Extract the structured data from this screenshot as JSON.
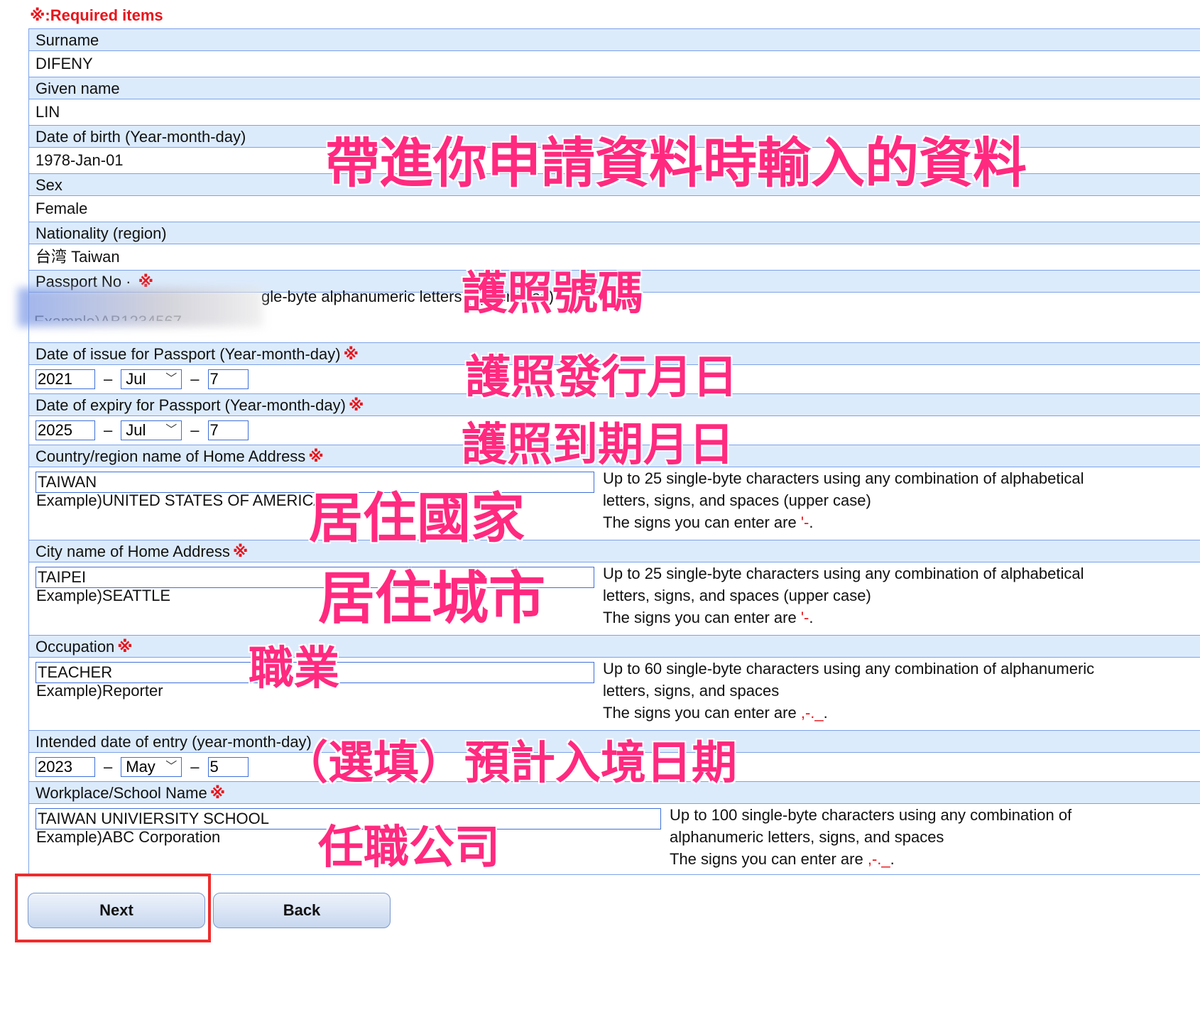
{
  "required_note": "※:Required items",
  "required_mark": "※",
  "fields": {
    "surname": {
      "label": "Surname",
      "value": "DIFENY"
    },
    "given_name": {
      "label": "Given name",
      "value": "LIN"
    },
    "dob": {
      "label": "Date of birth (Year-month-day)",
      "value": "1978-Jan-01"
    },
    "sex": {
      "label": "Sex",
      "value": "Female"
    },
    "nationality": {
      "label": "Nationality (region)",
      "value": "台湾 Taiwan"
    },
    "passport_no": {
      "label": "Passport No ·",
      "hint": "gle-byte alphanumeric letters (upper case)",
      "example": "Example)AB1234567"
    },
    "issue_date": {
      "label": "Date of issue for Passport (Year-month-day)",
      "year": "2021",
      "month": "Jul",
      "day": "7"
    },
    "expiry_date": {
      "label": "Date of expiry for Passport (Year-month-day)",
      "year": "2025",
      "month": "Jul",
      "day": "7"
    },
    "country": {
      "label": "Country/region name of Home Address",
      "value": "TAIWAN",
      "example": "Example)UNITED STATES OF AMERICA",
      "hint1": "Up to 25 single-byte characters using any combination of alphabetical",
      "hint2": "letters, signs, and spaces (upper case)",
      "hint3": "The signs you can enter are ",
      "signs": "'-",
      "hint_end": "."
    },
    "city": {
      "label": "City name of Home Address",
      "value": "TAIPEI",
      "example": "Example)SEATTLE",
      "hint1": "Up to 25 single-byte characters using any combination of alphabetical",
      "hint2": "letters, signs, and spaces (upper case)",
      "hint3": "The signs you can enter are ",
      "signs": "'-",
      "hint_end": "."
    },
    "occupation": {
      "label": "Occupation",
      "value": "TEACHER",
      "example": "Example)Reporter",
      "hint1": "Up to 60 single-byte characters using any combination of alphanumeric",
      "hint2": "letters, signs, and spaces",
      "hint3": "The signs you can enter are ",
      "signs": ",-._",
      "hint_end": "."
    },
    "entry_date": {
      "label": "Intended date of entry (year-month-day)",
      "year": "2023",
      "month": "May",
      "day": "5"
    },
    "workplace": {
      "label": "Workplace/School Name",
      "value": "TAIWAN UNIVIERSITY SCHOOL",
      "example": "Example)ABC Corporation",
      "hint1": "Up to 100 single-byte characters using any combination of",
      "hint2": "alphanumeric letters, signs, and spaces",
      "hint3": "The signs you can enter are ",
      "signs": ",-._",
      "hint_end": "."
    }
  },
  "buttons": {
    "next": "Next",
    "back": "Back"
  },
  "annotations": {
    "prefilled": "帶進你申請資料時輸入的資料",
    "passport_no": "護照號碼",
    "issue_date": "護照發行月日",
    "expiry_date": "護照到期月日",
    "country": "居住國家",
    "city": "居住城市",
    "occupation": "職業",
    "entry_date": "（選填）預計入境日期",
    "workplace": "任職公司"
  },
  "colors": {
    "accent_red": "#e8141b",
    "annotation_pink": "#ff2a7f",
    "header_bg": "#dcebfc",
    "border_blue": "#7da2e8"
  }
}
